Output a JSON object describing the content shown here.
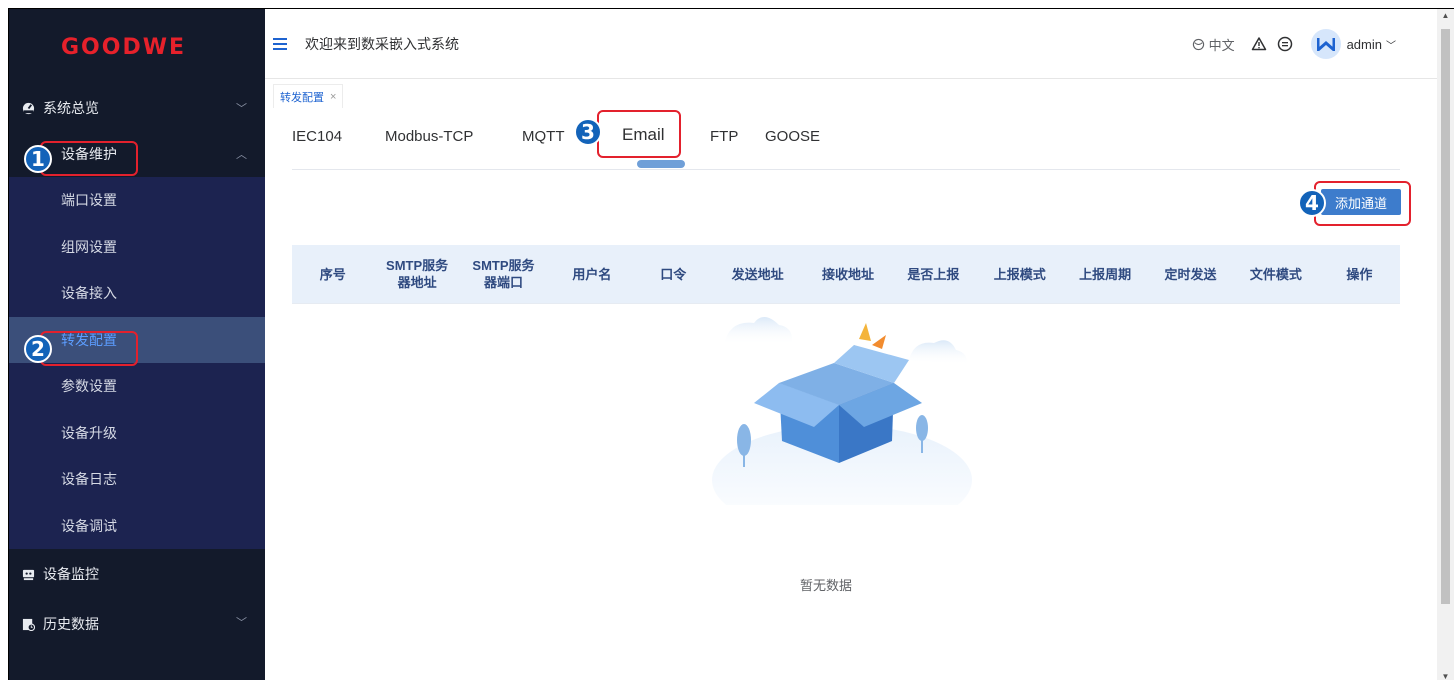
{
  "brand": {
    "logo_text": "GOODWE",
    "logo_color": "#e6212b"
  },
  "header": {
    "welcome": "欢迎来到数采嵌入式系统",
    "language": "中文",
    "username": "admin"
  },
  "sidebar": {
    "items": [
      {
        "label": "系统总览",
        "icon": "dashboard-icon"
      },
      {
        "label": "设备维护",
        "icon": "",
        "expanded": true
      },
      {
        "label": "设备监控",
        "icon": "monitor-icon"
      },
      {
        "label": "历史数据",
        "icon": "history-icon"
      }
    ],
    "submenu": [
      {
        "label": "端口设置"
      },
      {
        "label": "组网设置"
      },
      {
        "label": "设备接入"
      },
      {
        "label": "转发配置",
        "active": true
      },
      {
        "label": "参数设置"
      },
      {
        "label": "设备升级"
      },
      {
        "label": "设备日志"
      },
      {
        "label": "设备调试"
      }
    ]
  },
  "tagbar": {
    "tag_label": "转发配置",
    "close": "×"
  },
  "tabs": [
    {
      "label": "IEC104"
    },
    {
      "label": "Modbus-TCP"
    },
    {
      "label": "MQTT"
    },
    {
      "label": "Email",
      "active": true
    },
    {
      "label": "FTP"
    },
    {
      "label": "GOOSE"
    }
  ],
  "add_button": "添加通道",
  "table": {
    "columns": [
      "序号",
      "SMTP服务器地址",
      "SMTP服务器端口",
      "用户名",
      "口令",
      "发送地址",
      "接收地址",
      "是否上报",
      "上报模式",
      "上报周期",
      "定时发送",
      "文件模式",
      "操作"
    ],
    "column_lines": [
      [
        "序号"
      ],
      [
        "SMTP服务",
        "器地址"
      ],
      [
        "SMTP服务",
        "器端口"
      ],
      [
        "用户名"
      ],
      [
        "口令"
      ],
      [
        "发送地址"
      ],
      [
        "接收地址"
      ],
      [
        "是否上报"
      ],
      [
        "上报模式"
      ],
      [
        "上报周期"
      ],
      [
        "定时发送"
      ],
      [
        "文件模式"
      ],
      [
        "操作"
      ]
    ],
    "empty_text": "暂无数据"
  },
  "markers": [
    "1",
    "2",
    "3",
    "4"
  ],
  "colors": {
    "accent": "#3d7ccc",
    "marker": "#1363b9",
    "highlight": "#e3212d",
    "sidebar_bg": "#131a2b",
    "submenu_bg": "#1c2350"
  }
}
